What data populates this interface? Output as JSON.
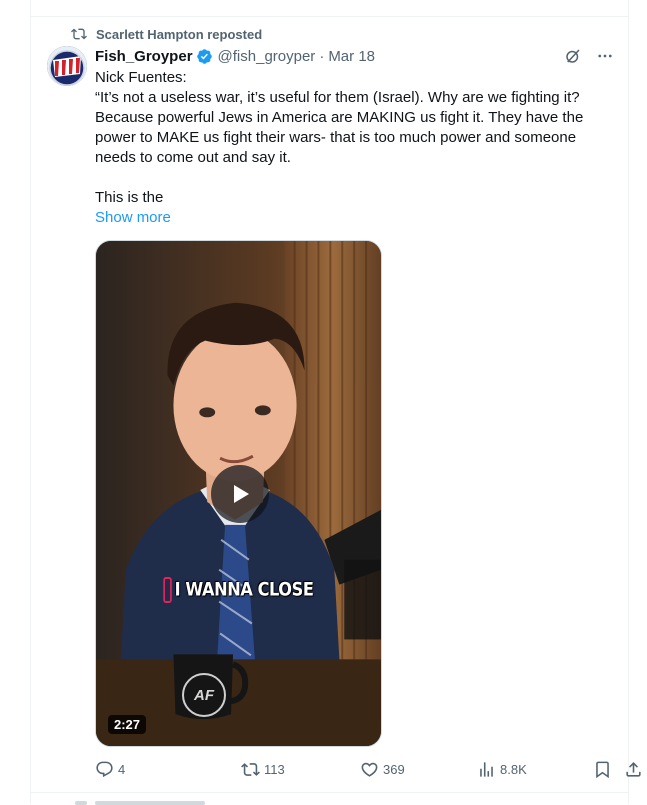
{
  "repost": {
    "label": "Scarlett Hampton reposted"
  },
  "tweet": {
    "author_name": "Fish_Groyper",
    "handle": "@fish_groyper",
    "separator": "·",
    "date": "Mar 18",
    "text_line1": "Nick Fuentes:",
    "text_line2": "“It’s not a useless war, it’s useful for them (Israel). Why are we fighting it? Because powerful Jews in America are MAKING us fight it. They have the power to MAKE us fight their wars- that is too much power and someone needs to come out and say it.",
    "text_line3": "This is the",
    "show_more": "Show more"
  },
  "video": {
    "caption": "I WANNA CLOSE",
    "mug_logo": "AF",
    "duration": "2:27"
  },
  "actions": {
    "replies": "4",
    "reposts": "113",
    "likes": "369",
    "views": "8.8K"
  },
  "colors": {
    "accent": "#1d9bf0",
    "secondary_text": "#536471",
    "border": "#eff3f4",
    "verified": "#1d9bf0"
  },
  "icons": [
    "repost-icon",
    "verified-badge-icon",
    "grok-icon",
    "more-icon",
    "play-icon",
    "reply-icon",
    "retweet-icon",
    "like-icon",
    "views-icon",
    "bookmark-icon",
    "share-icon"
  ]
}
